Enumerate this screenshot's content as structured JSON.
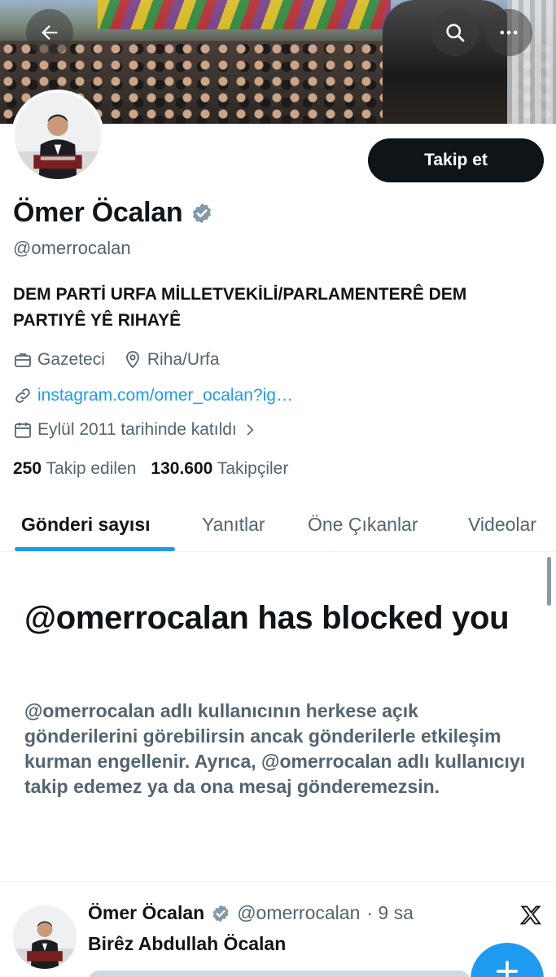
{
  "header": {
    "back_icon": "arrow-left-icon",
    "search_icon": "search-icon",
    "more_icon": "more-horizontal-icon"
  },
  "profile": {
    "name": "Ömer Öcalan",
    "handle": "@omerrocalan",
    "verified": true,
    "follow_label": "Takip et",
    "bio": "DEM PARTİ URFA MİLLETVEKİLİ/PARLAMENTERÊ DEM PARTIYÊ YÊ RIHAYÊ",
    "profession": "Gazeteci",
    "location": "Riha/Urfa",
    "link": "instagram.com/omer_ocalan?ig…",
    "joined": "Eylül 2011 tarihinde katıldı",
    "following_count": "250",
    "following_label": "Takip edilen",
    "followers_count": "130.600",
    "followers_label": "Takipçiler"
  },
  "tabs": [
    {
      "label": "Gönderi sayısı",
      "active": true
    },
    {
      "label": "Yanıtlar",
      "active": false
    },
    {
      "label": "Öne Çıkanlar",
      "active": false
    },
    {
      "label": "Videolar",
      "active": false
    }
  ],
  "blocked": {
    "title": "@omerrocalan has blocked you",
    "description": "@omerrocalan adlı kullanıcının herkese açık gönderilerini görebilirsin ancak gönderilerle etkileşim kurman engellenir. Ayrıca, @omerrocalan adlı kullanıcıyı takip edemez ya da ona mesaj gönderemezsin."
  },
  "tweet": {
    "name": "Ömer Öcalan",
    "handle": "@omerrocalan",
    "time": "· 9 sa",
    "text": "Birêz Abdullah Öcalan"
  },
  "colors": {
    "accent": "#1d9bf0",
    "text": "#0f1419",
    "muted": "#536471"
  }
}
